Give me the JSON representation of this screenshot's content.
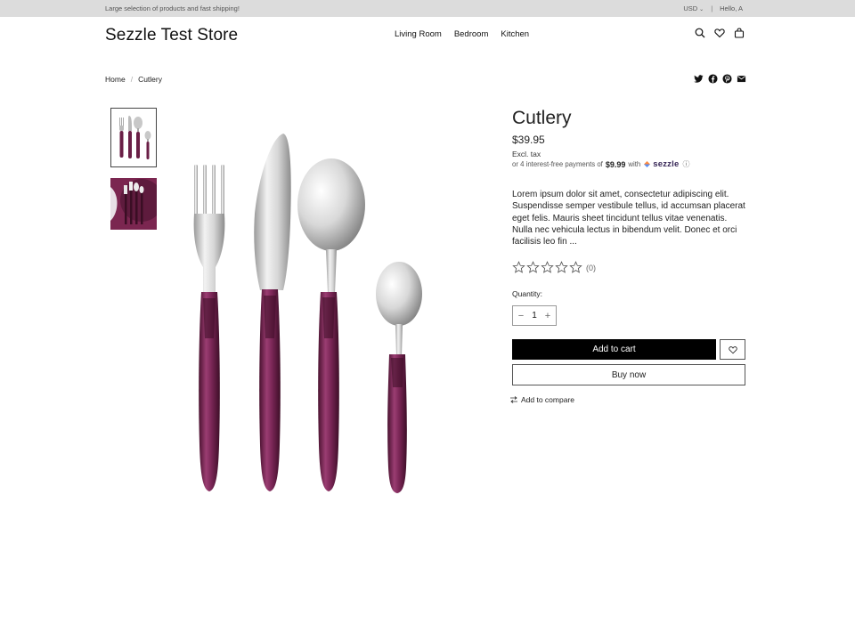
{
  "topbar": {
    "promo": "Large selection of products and fast shipping!",
    "currency": "USD",
    "separator": "|",
    "greeting": "Hello, A"
  },
  "header": {
    "logo": "Sezzle Test Store",
    "nav": [
      "Living Room",
      "Bedroom",
      "Kitchen"
    ],
    "icons": [
      "search-icon",
      "heart-icon",
      "bag-icon"
    ]
  },
  "breadcrumb": {
    "home": "Home",
    "separator": "/",
    "current": "Cutlery"
  },
  "share_icons": [
    "twitter-icon",
    "facebook-icon",
    "pinterest-icon",
    "email-icon"
  ],
  "product": {
    "title": "Cutlery",
    "price": "$39.95",
    "tax_note": "Excl. tax",
    "sezzle": {
      "prefix": "or 4 interest-free payments of",
      "amount": "$9.99",
      "with": "with",
      "brand": "sezzle",
      "info": "ⓘ"
    },
    "description": "Lorem ipsum dolor sit amet, consectetur adipiscing elit. Suspendisse semper vestibule tellus, id accumsan placerat eget felis. Mauris sheet tincidunt tellus vitae venenatis. Nulla nec vehicula lectus in bibendum velit. Donec et orci facilisis leo fin ...",
    "rating": {
      "stars": 0,
      "max": 5,
      "count": "(0)"
    },
    "quantity_label": "Quantity:",
    "quantity": "1",
    "minus": "−",
    "plus": "+",
    "add_to_cart": "Add to cart",
    "buy_now": "Buy now",
    "add_to_compare": "Add to compare"
  },
  "colors": {
    "topbar_bg": "#dcdcdc",
    "handle_purple": "#6a1f46",
    "button_black": "#000000",
    "sezzle_brand": "#382757"
  }
}
